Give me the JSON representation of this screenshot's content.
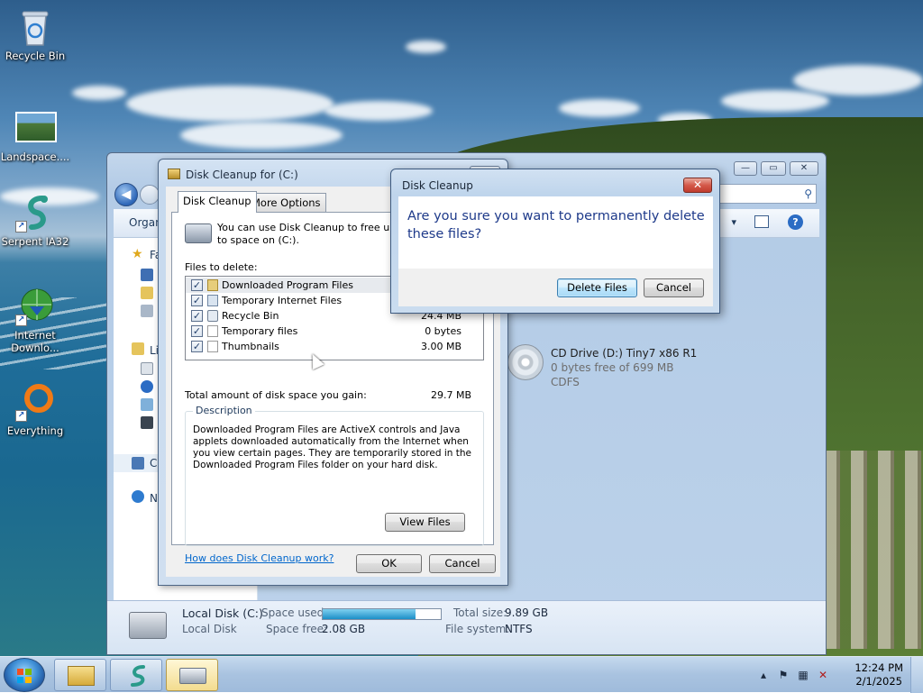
{
  "desktop": {
    "icons": [
      {
        "label": "Recycle Bin"
      },
      {
        "label": "Landspace...."
      },
      {
        "label": "Serpent IA32"
      },
      {
        "label": "Internet Downlo..."
      },
      {
        "label": "Everything"
      }
    ]
  },
  "explorer": {
    "organize_label": "Organ",
    "nav_favorites": "Fa",
    "nav_libraries": "Li",
    "nav_computer": "C",
    "nav_network": "N",
    "cd_drive": {
      "name": "CD Drive (D:) Tiny7 x86 R1",
      "free": "0 bytes free of 699 MB",
      "fs": "CDFS"
    },
    "status": {
      "drive_name": "Local Disk (C:)",
      "drive_type": "Local Disk",
      "space_used_label": "Space used:",
      "space_used_fraction": 0.79,
      "space_free_label": "Space free:",
      "space_free_value": "2.08 GB",
      "total_size_label": "Total size:",
      "total_size_value": "9.89 GB",
      "file_system_label": "File system:",
      "file_system_value": "NTFS"
    }
  },
  "disk_cleanup": {
    "title": "Disk Cleanup for  (C:)",
    "tabs": [
      {
        "label": "Disk Cleanup"
      },
      {
        "label": "More Options"
      }
    ],
    "intro": "You can use Disk Cleanup to free up to space on  (C:).",
    "files_label": "Files to delete:",
    "files": [
      {
        "name": "Downloaded Program Files",
        "size": "",
        "checked": true
      },
      {
        "name": "Temporary Internet Files",
        "size": "",
        "checked": true
      },
      {
        "name": "Recycle Bin",
        "size": "24.4 MB",
        "checked": true
      },
      {
        "name": "Temporary files",
        "size": "0 bytes",
        "checked": true
      },
      {
        "name": "Thumbnails",
        "size": "3.00 MB",
        "checked": true
      }
    ],
    "total_label": "Total amount of disk space you gain:",
    "total_value": "29.7 MB",
    "description_label": "Description",
    "description_text": "Downloaded Program Files are ActiveX controls and Java applets downloaded automatically from the Internet when you view certain pages. They are temporarily stored in the Downloaded Program Files folder on your hard disk.",
    "view_files_label": "View Files",
    "help_link": "How does Disk Cleanup work?",
    "ok_label": "OK",
    "cancel_label": "Cancel"
  },
  "confirm": {
    "title": "Disk Cleanup",
    "message": "Are you sure you want to permanently delete these files?",
    "delete_label": "Delete Files",
    "cancel_label": "Cancel",
    "close_glyph": "✕"
  },
  "taskbar": {
    "time": "12:24 PM",
    "date": "2/1/2025"
  }
}
